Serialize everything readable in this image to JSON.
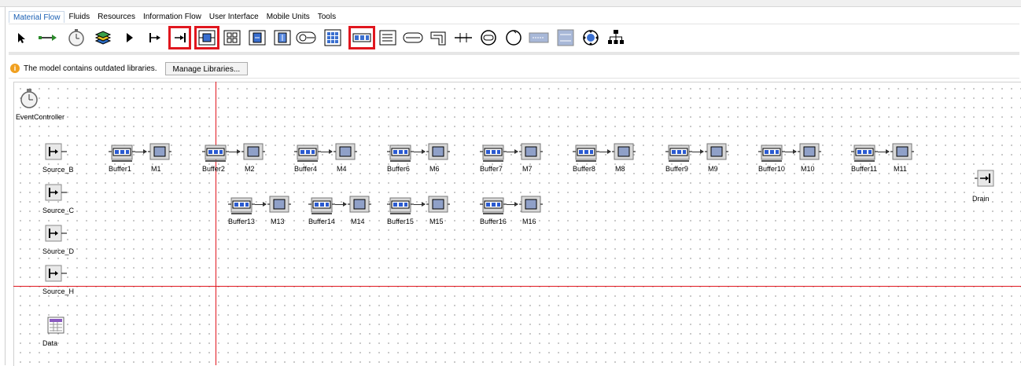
{
  "tabs": [
    "Material Flow",
    "Fluids",
    "Resources",
    "Information Flow",
    "User Interface",
    "Mobile Units",
    "Tools"
  ],
  "active_tab": "Material Flow",
  "toolbar_icons": [
    "pointer-icon",
    "connector-icon",
    "event-controller-icon",
    "frame-icon",
    "interface-icon",
    "source-icon",
    "drain-icon",
    "singleproc-icon",
    "parallelproc-icon",
    "assembly-icon",
    "disassembly-icon",
    "shelf-icon",
    "store-icon",
    "buffer-icon",
    "sorter-icon",
    "line-icon",
    "angular-converter-icon",
    "turntable-icon",
    "turnplate-icon",
    "cycle-icon",
    "circle-icon",
    "converter-icon",
    "flow-control-icon",
    "exporter-icon",
    "hierarchy-icon"
  ],
  "highlighted_tools": [
    "drain-icon",
    "singleproc-icon",
    "buffer-icon"
  ],
  "infobar": {
    "message": "The model contains outdated libraries.",
    "button": "Manage Libraries..."
  },
  "canvas": {
    "event_controller": "EventController",
    "sources": [
      "Source_B",
      "Source_C",
      "Source_D",
      "Source_H"
    ],
    "drain": "Drain",
    "data_table": "Data",
    "row1": [
      {
        "buffer": "Buffer1",
        "machine": "M1"
      },
      {
        "buffer": "Buffer2",
        "machine": "M2"
      },
      {
        "buffer": "Buffer4",
        "machine": "M4"
      },
      {
        "buffer": "Buffer6",
        "machine": "M6"
      },
      {
        "buffer": "Buffer7",
        "machine": "M7"
      },
      {
        "buffer": "Buffer8",
        "machine": "M8"
      },
      {
        "buffer": "Buffer9",
        "machine": "M9"
      },
      {
        "buffer": "Buffer10",
        "machine": "M10"
      },
      {
        "buffer": "Buffer11",
        "machine": "M11"
      }
    ],
    "row2": [
      {
        "buffer": "Buffer13",
        "machine": "M13"
      },
      {
        "buffer": "Buffer14",
        "machine": "M14"
      },
      {
        "buffer": "Buffer15",
        "machine": "M15"
      },
      {
        "buffer": "Buffer16",
        "machine": "M16"
      }
    ]
  },
  "colors": {
    "highlight": "#e0161e",
    "accent": "#1a5fb4",
    "grid_dot": "#9a9a9a"
  }
}
